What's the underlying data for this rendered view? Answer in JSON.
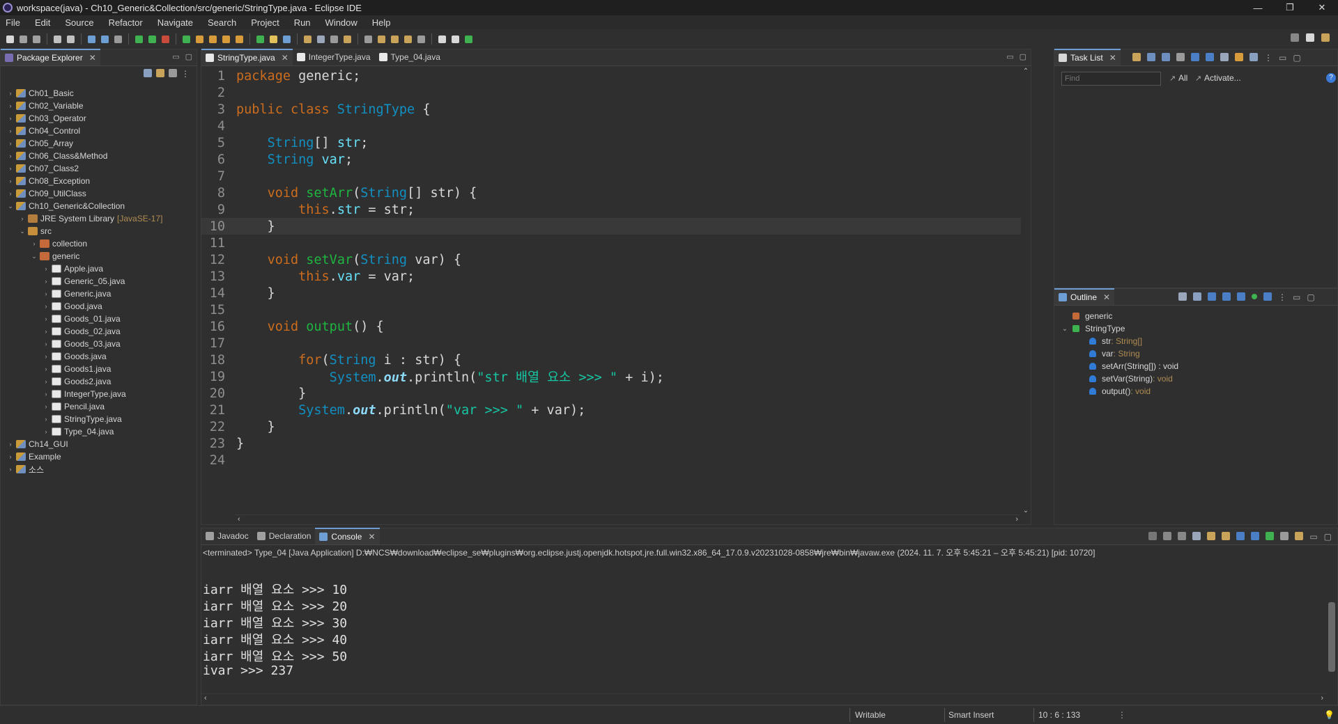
{
  "window": {
    "title": "workspace(java) - Ch10_Generic&Collection/src/generic/StringType.java - Eclipse IDE",
    "controls": [
      "—",
      "❐",
      "✕"
    ]
  },
  "menu": [
    "File",
    "Edit",
    "Source",
    "Refactor",
    "Navigate",
    "Search",
    "Project",
    "Run",
    "Window",
    "Help"
  ],
  "package_explorer": {
    "title": "Package Explorer",
    "tree": [
      {
        "label": "Ch01_Basic",
        "depth": 0,
        "toggle": "›",
        "icon": "proj"
      },
      {
        "label": "Ch02_Variable",
        "depth": 0,
        "toggle": "›",
        "icon": "proj"
      },
      {
        "label": "Ch03_Operator",
        "depth": 0,
        "toggle": "›",
        "icon": "proj"
      },
      {
        "label": "Ch04_Control",
        "depth": 0,
        "toggle": "›",
        "icon": "proj"
      },
      {
        "label": "Ch05_Array",
        "depth": 0,
        "toggle": "›",
        "icon": "proj"
      },
      {
        "label": "Ch06_Class&Method",
        "depth": 0,
        "toggle": "›",
        "icon": "proj"
      },
      {
        "label": "Ch07_Class2",
        "depth": 0,
        "toggle": "›",
        "icon": "proj"
      },
      {
        "label": "Ch08_Exception",
        "depth": 0,
        "toggle": "›",
        "icon": "proj"
      },
      {
        "label": "Ch09_UtilClass",
        "depth": 0,
        "toggle": "›",
        "icon": "proj"
      },
      {
        "label": "Ch10_Generic&Collection",
        "depth": 0,
        "toggle": "⌄",
        "icon": "proj"
      },
      {
        "label": "JRE System Library",
        "suffix": "[JavaSE-17]",
        "depth": 1,
        "toggle": "›",
        "icon": "lib"
      },
      {
        "label": "src",
        "depth": 1,
        "toggle": "⌄",
        "icon": "src"
      },
      {
        "label": "collection",
        "depth": 2,
        "toggle": "›",
        "icon": "pkgi"
      },
      {
        "label": "generic",
        "depth": 2,
        "toggle": "⌄",
        "icon": "pkgi"
      },
      {
        "label": "Apple.java",
        "depth": 3,
        "toggle": "›",
        "icon": "java"
      },
      {
        "label": "Generic_05.java",
        "depth": 3,
        "toggle": "›",
        "icon": "java"
      },
      {
        "label": "Generic.java",
        "depth": 3,
        "toggle": "›",
        "icon": "java"
      },
      {
        "label": "Good.java",
        "depth": 3,
        "toggle": "›",
        "icon": "java"
      },
      {
        "label": "Goods_01.java",
        "depth": 3,
        "toggle": "›",
        "icon": "java"
      },
      {
        "label": "Goods_02.java",
        "depth": 3,
        "toggle": "›",
        "icon": "java"
      },
      {
        "label": "Goods_03.java",
        "depth": 3,
        "toggle": "›",
        "icon": "java"
      },
      {
        "label": "Goods.java",
        "depth": 3,
        "toggle": "›",
        "icon": "java"
      },
      {
        "label": "Goods1.java",
        "depth": 3,
        "toggle": "›",
        "icon": "java"
      },
      {
        "label": "Goods2.java",
        "depth": 3,
        "toggle": "›",
        "icon": "java"
      },
      {
        "label": "IntegerType.java",
        "depth": 3,
        "toggle": "›",
        "icon": "java"
      },
      {
        "label": "Pencil.java",
        "depth": 3,
        "toggle": "›",
        "icon": "java"
      },
      {
        "label": "StringType.java",
        "depth": 3,
        "toggle": "›",
        "icon": "java"
      },
      {
        "label": "Type_04.java",
        "depth": 3,
        "toggle": "›",
        "icon": "java"
      },
      {
        "label": "Ch14_GUI",
        "depth": 0,
        "toggle": "›",
        "icon": "proj"
      },
      {
        "label": "Example",
        "depth": 0,
        "toggle": "›",
        "icon": "proj"
      },
      {
        "label": "소스",
        "depth": 0,
        "toggle": "›",
        "icon": "proj"
      }
    ]
  },
  "editor": {
    "tabs": [
      {
        "label": "StringType.java",
        "active": true,
        "close": "✕"
      },
      {
        "label": "IntegerType.java",
        "active": false
      },
      {
        "label": "Type_04.java",
        "active": false
      }
    ],
    "current_line": 10,
    "lines": [
      [
        [
          "kw",
          "package"
        ],
        [
          "vr",
          " generic;"
        ]
      ],
      [],
      [
        [
          "kw",
          "public class "
        ],
        [
          "ty",
          "StringType"
        ],
        [
          "vr",
          " {"
        ]
      ],
      [],
      [
        [
          "vr",
          "    "
        ],
        [
          "ty",
          "String"
        ],
        [
          "vr",
          "[] "
        ],
        [
          "fd",
          "str"
        ],
        [
          "vr",
          ";"
        ]
      ],
      [
        [
          "vr",
          "    "
        ],
        [
          "ty",
          "String"
        ],
        [
          "vr",
          " "
        ],
        [
          "fd",
          "var"
        ],
        [
          "vr",
          ";"
        ]
      ],
      [],
      [
        [
          "vr",
          "    "
        ],
        [
          "kw",
          "void "
        ],
        [
          "fn",
          "setArr"
        ],
        [
          "vr",
          "("
        ],
        [
          "ty",
          "String"
        ],
        [
          "vr",
          "[] str) {"
        ]
      ],
      [
        [
          "vr",
          "        "
        ],
        [
          "kw",
          "this"
        ],
        [
          "vr",
          "."
        ],
        [
          "fd",
          "str"
        ],
        [
          "vr",
          " = str;"
        ]
      ],
      [
        [
          "vr",
          "    }"
        ]
      ],
      [],
      [
        [
          "vr",
          "    "
        ],
        [
          "kw",
          "void "
        ],
        [
          "fn",
          "setVar"
        ],
        [
          "vr",
          "("
        ],
        [
          "ty",
          "String"
        ],
        [
          "vr",
          " var) {"
        ]
      ],
      [
        [
          "vr",
          "        "
        ],
        [
          "kw",
          "this"
        ],
        [
          "vr",
          "."
        ],
        [
          "fd",
          "var"
        ],
        [
          "vr",
          " = var;"
        ]
      ],
      [
        [
          "vr",
          "    }"
        ]
      ],
      [],
      [
        [
          "vr",
          "    "
        ],
        [
          "kw",
          "void "
        ],
        [
          "fn",
          "output"
        ],
        [
          "vr",
          "() {"
        ]
      ],
      [],
      [
        [
          "vr",
          "        "
        ],
        [
          "kw",
          "for"
        ],
        [
          "vr",
          "("
        ],
        [
          "ty",
          "String"
        ],
        [
          "vr",
          " i : str) {"
        ]
      ],
      [
        [
          "vr",
          "            "
        ],
        [
          "ty",
          "System"
        ],
        [
          "vr",
          "."
        ],
        [
          "stf",
          "out"
        ],
        [
          "vr",
          ".println("
        ],
        [
          "st",
          "\"str 배열 요소 >>> \""
        ],
        [
          "vr",
          " + i);"
        ]
      ],
      [
        [
          "vr",
          "        }"
        ]
      ],
      [
        [
          "vr",
          "        "
        ],
        [
          "ty",
          "System"
        ],
        [
          "vr",
          "."
        ],
        [
          "stf",
          "out"
        ],
        [
          "vr",
          ".println("
        ],
        [
          "st",
          "\"var >>> \""
        ],
        [
          "vr",
          " + var);"
        ]
      ],
      [
        [
          "vr",
          "    }"
        ]
      ],
      [
        [
          "vr",
          "}"
        ]
      ],
      []
    ]
  },
  "task_list": {
    "title": "Task List",
    "find_placeholder": "Find",
    "all_label": "All",
    "activate_label": "Activate..."
  },
  "outline": {
    "title": "Outline",
    "items": [
      {
        "label": "generic",
        "suffix": "",
        "depth": 0,
        "color": "#c4693a"
      },
      {
        "label": "StringType",
        "suffix": "",
        "depth": 0,
        "color": "#3fb150",
        "toggle": "⌄"
      },
      {
        "label": "str",
        "suffix": " : String[]",
        "depth": 1,
        "color": "#2f7bd6"
      },
      {
        "label": "var",
        "suffix": " : String",
        "depth": 1,
        "color": "#2f7bd6"
      },
      {
        "label": "setArr(String[]) : void",
        "suffix": "",
        "depth": 1,
        "color": "#2f7bd6"
      },
      {
        "label": "setVar(String)",
        "suffix": " : void",
        "depth": 1,
        "color": "#2f7bd6"
      },
      {
        "label": "output()",
        "suffix": " : void",
        "depth": 1,
        "color": "#2f7bd6"
      }
    ]
  },
  "console": {
    "tabs": [
      {
        "label": "Javadoc",
        "active": false
      },
      {
        "label": "Declaration",
        "active": false
      },
      {
        "label": "Console",
        "active": true,
        "close": "✕"
      }
    ],
    "header": "<terminated> Type_04 [Java Application] D:₩NCS₩download₩eclipse_se₩plugins₩org.eclipse.justj.openjdk.hotspot.jre.full.win32.x86_64_17.0.9.v20231028-0858₩jre₩bin₩javaw.exe  (2024. 11. 7. 오후 5:45:21 – 오후 5:45:21) [pid: 10720]",
    "output": [
      "iarr 배열 요소 >>> 10",
      "iarr 배열 요소 >>> 20",
      "iarr 배열 요소 >>> 30",
      "iarr 배열 요소 >>> 40",
      "iarr 배열 요소 >>> 50",
      "ivar >>> 237"
    ]
  },
  "status": {
    "writable": "Writable",
    "insert_mode": "Smart Insert",
    "position": "10 : 6 : 133"
  },
  "colors": {
    "accent": "#6d9fd5",
    "keyword": "#cc6c1d",
    "type": "#1290c3",
    "method": "#1eb540",
    "field": "#66e1f8",
    "string": "#17c6a3"
  }
}
